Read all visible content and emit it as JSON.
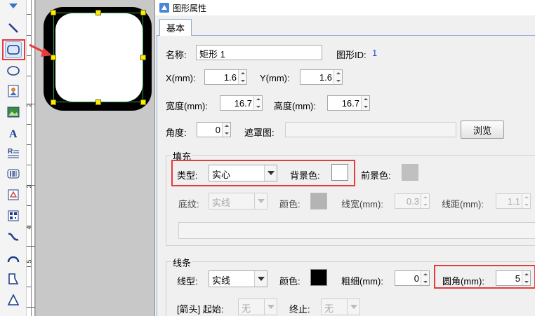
{
  "dialog": {
    "title": "图形属性",
    "tab": "基本"
  },
  "toolbox": {
    "tools": [
      {
        "icon": "shapes-icon"
      },
      {
        "icon": "line-icon"
      },
      {
        "icon": "rounded-rect-icon"
      },
      {
        "icon": "ellipse-icon"
      },
      {
        "icon": "image-icon"
      },
      {
        "icon": "picture-icon"
      },
      {
        "icon": "text-icon"
      },
      {
        "icon": "multiline-text-icon"
      },
      {
        "icon": "barcode-icon"
      },
      {
        "icon": "shape-icon"
      },
      {
        "icon": "qrcode-icon"
      },
      {
        "icon": "curve-icon"
      },
      {
        "icon": "arc-icon"
      },
      {
        "icon": "polygon-icon"
      },
      {
        "icon": "triangle-icon"
      }
    ]
  },
  "ruler": {
    "numbers": [
      "2",
      "3",
      "4",
      "5"
    ]
  },
  "props": {
    "name_label": "名称:",
    "name_value": "矩形 1",
    "id_label": "图形ID:",
    "id_value": "1",
    "x_label": "X(mm):",
    "x_value": "1.6",
    "y_label": "Y(mm):",
    "y_value": "1.6",
    "width_label": "宽度(mm):",
    "width_value": "16.7",
    "height_label": "高度(mm):",
    "height_value": "16.7",
    "angle_label": "角度:",
    "angle_value": "0",
    "mask_label": "遮罩图:",
    "mask_value": "",
    "browse_label": "浏览"
  },
  "fill": {
    "group_title": "填充",
    "type_label": "类型:",
    "type_value": "实心",
    "bg_label": "背景色:",
    "bg_color": "#ffffff",
    "fg_label": "前景色:",
    "fg_color": "#c0c0c0",
    "texture_label": "底纹:",
    "texture_value": "实线",
    "color_label": "颜色:",
    "color_value": "#b4b4b4",
    "linewidth_label": "线宽(mm):",
    "linewidth_value": "0.3",
    "linespacing_label": "线距(mm):",
    "linespacing_value": "1.1"
  },
  "stroke": {
    "group_title": "线条",
    "linetype_label": "线型:",
    "linetype_value": "实线",
    "color_label": "颜色:",
    "color_value": "#000000",
    "thickness_label": "粗细(mm):",
    "thickness_value": "0",
    "corner_label": "圆角(mm):",
    "corner_value": "5",
    "arrow_label": "[箭头] 起始:",
    "arrow_start_value": "无",
    "arrow_end_label": "终止:",
    "arrow_end_value": "无"
  },
  "colors": {
    "highlight": "#e43b3b",
    "selection": "#2ea043",
    "handle": "#ffeb00",
    "id_blue": "#1a4fd0"
  }
}
